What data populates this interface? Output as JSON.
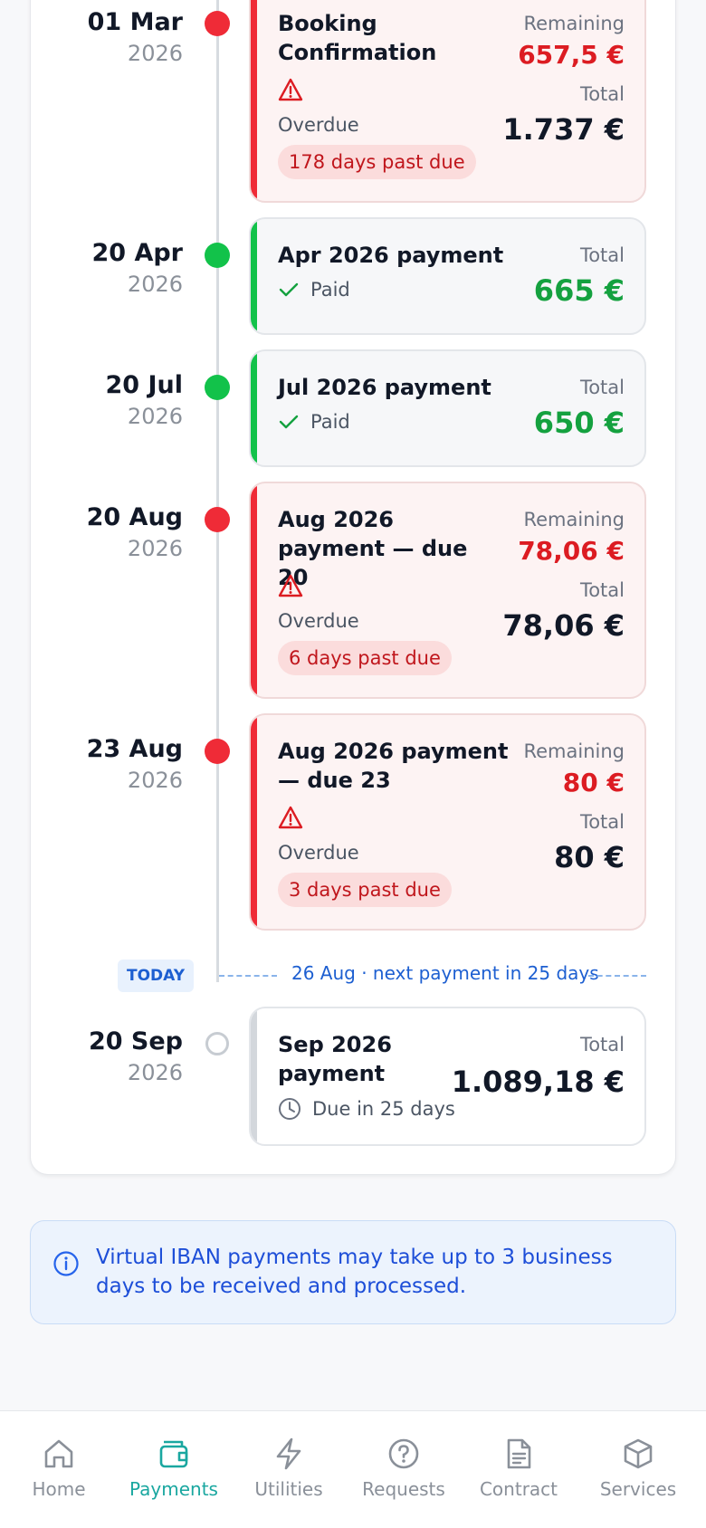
{
  "timeline": {
    "entries": [
      {
        "date_day": "01 Mar",
        "date_year": "2026",
        "title": "Booking Confirmation",
        "status": "Overdue",
        "remaining_label": "Remaining",
        "remaining": "657,5 €",
        "total_label": "Total",
        "total": "1.737 €",
        "past_due": "178 days past due"
      },
      {
        "date_day": "20 Apr",
        "date_year": "2026",
        "title": "Apr 2026 payment",
        "status": "Paid",
        "total_label": "Total",
        "total": "665 €"
      },
      {
        "date_day": "20 Jul",
        "date_year": "2026",
        "title": "Jul 2026 payment",
        "status": "Paid",
        "total_label": "Total",
        "total": "650 €"
      },
      {
        "date_day": "20 Aug",
        "date_year": "2026",
        "title": "Aug 2026 payment — due 20",
        "status": "Overdue",
        "remaining_label": "Remaining",
        "remaining": "78,06 €",
        "total_label": "Total",
        "total": "78,06 €",
        "past_due": "6 days past due"
      },
      {
        "date_day": "23 Aug",
        "date_year": "2026",
        "title": "Aug 2026 payment — due 23",
        "status": "Overdue",
        "remaining_label": "Remaining",
        "remaining": "80 €",
        "total_label": "Total",
        "total": "80 €",
        "past_due": "3 days past due"
      },
      {
        "date_day": "20 Sep",
        "date_year": "2026",
        "title": "Sep 2026 payment",
        "status": "Due in 25 days",
        "total_label": "Total",
        "total": "1.089,18 €"
      }
    ],
    "today_badge": "TODAY",
    "today_text": "26 Aug · next payment in 25 days"
  },
  "info": {
    "text": "Virtual IBAN payments may take up to 3 business days to be received and processed."
  },
  "nav": {
    "items": [
      {
        "label": "Home",
        "icon": "home-icon"
      },
      {
        "label": "Payments",
        "icon": "wallet-icon",
        "active": true
      },
      {
        "label": "Utilities",
        "icon": "bolt-icon"
      },
      {
        "label": "Requests",
        "icon": "help-circle-icon"
      },
      {
        "label": "Contract",
        "icon": "document-icon"
      },
      {
        "label": "Services",
        "icon": "box-icon"
      }
    ]
  },
  "colors": {
    "overdue": "#ef2b37",
    "paid": "#12c24a",
    "accent": "#1aa7a0",
    "info": "#1d4ed8"
  }
}
